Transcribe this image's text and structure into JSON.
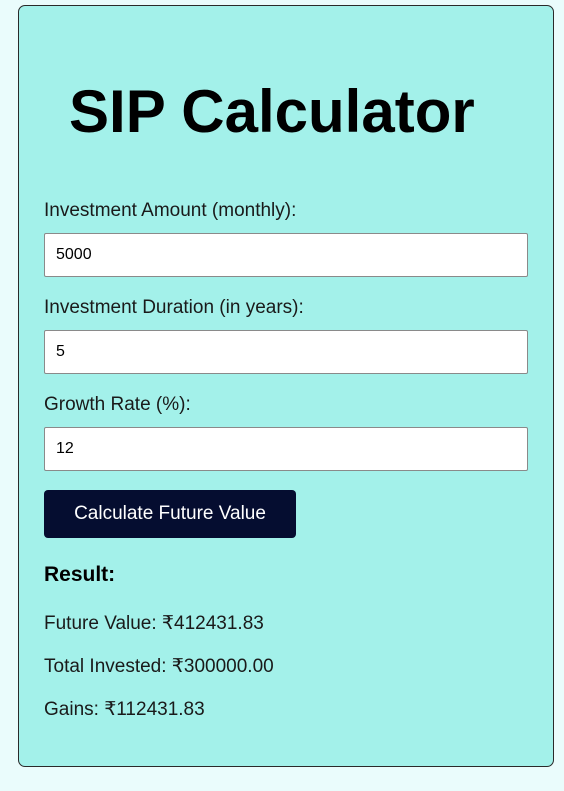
{
  "calculator": {
    "title": "SIP Calculator",
    "amount_label": "Investment Amount (monthly):",
    "amount_value": "5000",
    "duration_label": "Investment Duration (in years):",
    "duration_value": "5",
    "rate_label": "Growth Rate (%):",
    "rate_value": "12",
    "calculate_label": "Calculate Future Value"
  },
  "result": {
    "heading": "Result:",
    "future_value": "Future Value: ₹412431.83",
    "total_invested": "Total Invested: ₹300000.00",
    "gains": "Gains: ₹112431.83"
  },
  "colors": {
    "card_background": "#a3f1ea",
    "page_background": "#eafcfc",
    "button_background": "#050d30"
  }
}
